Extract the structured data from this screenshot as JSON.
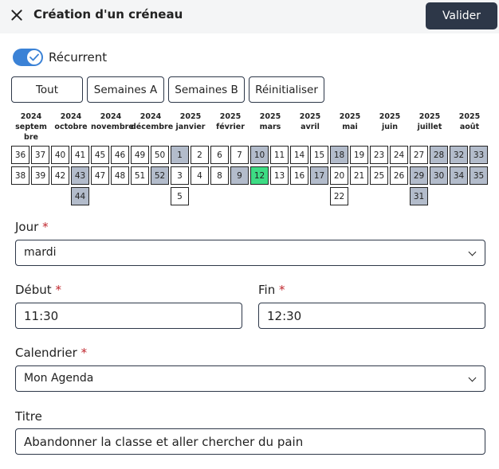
{
  "header": {
    "title": "Création d'un créneau",
    "validate_label": "Valider"
  },
  "recurrent": {
    "label": "Récurrent",
    "enabled": true
  },
  "filters": [
    "Tout",
    "Semaines A",
    "Semaines B",
    "Réinitialiser"
  ],
  "months": [
    {
      "year": "2024",
      "name": "septembre"
    },
    {
      "year": "2024",
      "name": "octobre"
    },
    {
      "year": "2024",
      "name": "novembre"
    },
    {
      "year": "2024",
      "name": "décembre"
    },
    {
      "year": "2025",
      "name": "janvier"
    },
    {
      "year": "2025",
      "name": "février"
    },
    {
      "year": "2025",
      "name": "mars"
    },
    {
      "year": "2025",
      "name": "avril"
    },
    {
      "year": "2025",
      "name": "mai"
    },
    {
      "year": "2025",
      "name": "juin"
    },
    {
      "year": "2025",
      "name": "juillet"
    },
    {
      "year": "2025",
      "name": "août"
    }
  ],
  "weeks": [
    [
      {
        "n": "36"
      },
      {
        "n": "38"
      }
    ],
    [
      {
        "n": "37"
      },
      {
        "n": "39"
      }
    ],
    [
      {
        "n": "40"
      },
      {
        "n": "42"
      }
    ],
    [
      {
        "n": "41"
      },
      {
        "n": "43",
        "s": true
      },
      {
        "n": "44",
        "s": true
      }
    ],
    [
      {
        "n": "45"
      },
      {
        "n": "47"
      }
    ],
    [
      {
        "n": "46"
      },
      {
        "n": "48"
      }
    ],
    [
      {
        "n": "49"
      },
      {
        "n": "51"
      }
    ],
    [
      {
        "n": "50"
      },
      {
        "n": "52",
        "s": true
      }
    ],
    [
      {
        "n": "1",
        "s": true
      },
      {
        "n": "3"
      },
      {
        "n": "5"
      }
    ],
    [
      {
        "n": "2"
      },
      {
        "n": "4"
      }
    ],
    [
      {
        "n": "6"
      },
      {
        "n": "8"
      }
    ],
    [
      {
        "n": "7"
      },
      {
        "n": "9",
        "s": true
      }
    ],
    [
      {
        "n": "10",
        "s": true
      },
      {
        "n": "12",
        "t": true
      }
    ],
    [
      {
        "n": "11"
      },
      {
        "n": "13"
      }
    ],
    [
      {
        "n": "14"
      },
      {
        "n": "16"
      }
    ],
    [
      {
        "n": "15"
      },
      {
        "n": "17",
        "s": true
      }
    ],
    [
      {
        "n": "18",
        "s": true
      },
      {
        "n": "20"
      },
      {
        "n": "22"
      }
    ],
    [
      {
        "n": "19"
      },
      {
        "n": "21"
      }
    ],
    [
      {
        "n": "23"
      },
      {
        "n": "25"
      }
    ],
    [
      {
        "n": "24"
      },
      {
        "n": "26"
      }
    ],
    [
      {
        "n": "27"
      },
      {
        "n": "29",
        "s": true
      },
      {
        "n": "31",
        "s": true
      }
    ],
    [
      {
        "n": "28",
        "s": true
      },
      {
        "n": "30",
        "s": true
      }
    ],
    [
      {
        "n": "32",
        "s": true
      },
      {
        "n": "34",
        "s": true
      }
    ],
    [
      {
        "n": "33",
        "s": true
      },
      {
        "n": "35",
        "s": true
      }
    ]
  ],
  "colors": {
    "selected": "#b3bccb",
    "today": "#3ddc84",
    "accent": "#3b82d6",
    "primary_button": "#2d3748",
    "required": "#c0262d"
  },
  "fields": {
    "jour": {
      "label": "Jour",
      "required": "*",
      "value": "mardi"
    },
    "debut": {
      "label": "Début",
      "required": "*",
      "value": "11:30"
    },
    "fin": {
      "label": "Fin",
      "required": "*",
      "value": "12:30"
    },
    "calendrier": {
      "label": "Calendrier",
      "required": "*",
      "value": "Mon Agenda"
    },
    "titre": {
      "label": "Titre",
      "value": "Abandonner la classe et aller chercher du pain"
    }
  }
}
